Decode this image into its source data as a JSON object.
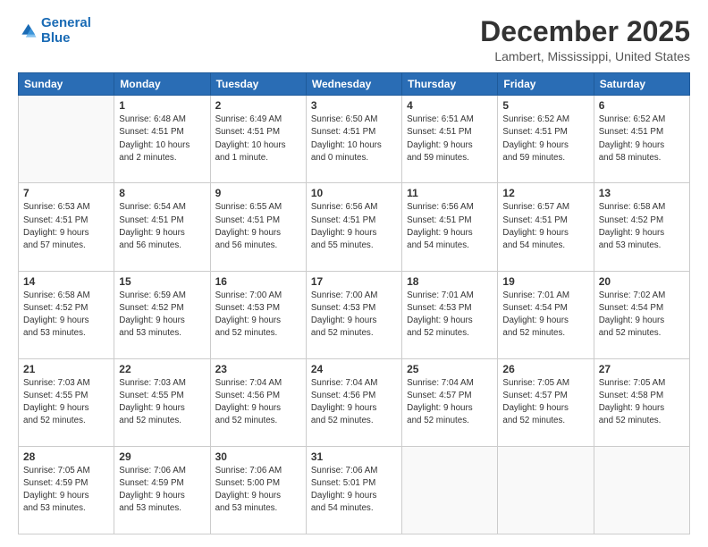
{
  "header": {
    "logo_line1": "General",
    "logo_line2": "Blue",
    "title": "December 2025",
    "subtitle": "Lambert, Mississippi, United States"
  },
  "calendar": {
    "weekdays": [
      "Sunday",
      "Monday",
      "Tuesday",
      "Wednesday",
      "Thursday",
      "Friday",
      "Saturday"
    ],
    "rows": [
      [
        {
          "day": "",
          "info": ""
        },
        {
          "day": "1",
          "info": "Sunrise: 6:48 AM\nSunset: 4:51 PM\nDaylight: 10 hours\nand 2 minutes."
        },
        {
          "day": "2",
          "info": "Sunrise: 6:49 AM\nSunset: 4:51 PM\nDaylight: 10 hours\nand 1 minute."
        },
        {
          "day": "3",
          "info": "Sunrise: 6:50 AM\nSunset: 4:51 PM\nDaylight: 10 hours\nand 0 minutes."
        },
        {
          "day": "4",
          "info": "Sunrise: 6:51 AM\nSunset: 4:51 PM\nDaylight: 9 hours\nand 59 minutes."
        },
        {
          "day": "5",
          "info": "Sunrise: 6:52 AM\nSunset: 4:51 PM\nDaylight: 9 hours\nand 59 minutes."
        },
        {
          "day": "6",
          "info": "Sunrise: 6:52 AM\nSunset: 4:51 PM\nDaylight: 9 hours\nand 58 minutes."
        }
      ],
      [
        {
          "day": "7",
          "info": "Sunrise: 6:53 AM\nSunset: 4:51 PM\nDaylight: 9 hours\nand 57 minutes."
        },
        {
          "day": "8",
          "info": "Sunrise: 6:54 AM\nSunset: 4:51 PM\nDaylight: 9 hours\nand 56 minutes."
        },
        {
          "day": "9",
          "info": "Sunrise: 6:55 AM\nSunset: 4:51 PM\nDaylight: 9 hours\nand 56 minutes."
        },
        {
          "day": "10",
          "info": "Sunrise: 6:56 AM\nSunset: 4:51 PM\nDaylight: 9 hours\nand 55 minutes."
        },
        {
          "day": "11",
          "info": "Sunrise: 6:56 AM\nSunset: 4:51 PM\nDaylight: 9 hours\nand 54 minutes."
        },
        {
          "day": "12",
          "info": "Sunrise: 6:57 AM\nSunset: 4:51 PM\nDaylight: 9 hours\nand 54 minutes."
        },
        {
          "day": "13",
          "info": "Sunrise: 6:58 AM\nSunset: 4:52 PM\nDaylight: 9 hours\nand 53 minutes."
        }
      ],
      [
        {
          "day": "14",
          "info": "Sunrise: 6:58 AM\nSunset: 4:52 PM\nDaylight: 9 hours\nand 53 minutes."
        },
        {
          "day": "15",
          "info": "Sunrise: 6:59 AM\nSunset: 4:52 PM\nDaylight: 9 hours\nand 53 minutes."
        },
        {
          "day": "16",
          "info": "Sunrise: 7:00 AM\nSunset: 4:53 PM\nDaylight: 9 hours\nand 52 minutes."
        },
        {
          "day": "17",
          "info": "Sunrise: 7:00 AM\nSunset: 4:53 PM\nDaylight: 9 hours\nand 52 minutes."
        },
        {
          "day": "18",
          "info": "Sunrise: 7:01 AM\nSunset: 4:53 PM\nDaylight: 9 hours\nand 52 minutes."
        },
        {
          "day": "19",
          "info": "Sunrise: 7:01 AM\nSunset: 4:54 PM\nDaylight: 9 hours\nand 52 minutes."
        },
        {
          "day": "20",
          "info": "Sunrise: 7:02 AM\nSunset: 4:54 PM\nDaylight: 9 hours\nand 52 minutes."
        }
      ],
      [
        {
          "day": "21",
          "info": "Sunrise: 7:03 AM\nSunset: 4:55 PM\nDaylight: 9 hours\nand 52 minutes."
        },
        {
          "day": "22",
          "info": "Sunrise: 7:03 AM\nSunset: 4:55 PM\nDaylight: 9 hours\nand 52 minutes."
        },
        {
          "day": "23",
          "info": "Sunrise: 7:04 AM\nSunset: 4:56 PM\nDaylight: 9 hours\nand 52 minutes."
        },
        {
          "day": "24",
          "info": "Sunrise: 7:04 AM\nSunset: 4:56 PM\nDaylight: 9 hours\nand 52 minutes."
        },
        {
          "day": "25",
          "info": "Sunrise: 7:04 AM\nSunset: 4:57 PM\nDaylight: 9 hours\nand 52 minutes."
        },
        {
          "day": "26",
          "info": "Sunrise: 7:05 AM\nSunset: 4:57 PM\nDaylight: 9 hours\nand 52 minutes."
        },
        {
          "day": "27",
          "info": "Sunrise: 7:05 AM\nSunset: 4:58 PM\nDaylight: 9 hours\nand 52 minutes."
        }
      ],
      [
        {
          "day": "28",
          "info": "Sunrise: 7:05 AM\nSunset: 4:59 PM\nDaylight: 9 hours\nand 53 minutes."
        },
        {
          "day": "29",
          "info": "Sunrise: 7:06 AM\nSunset: 4:59 PM\nDaylight: 9 hours\nand 53 minutes."
        },
        {
          "day": "30",
          "info": "Sunrise: 7:06 AM\nSunset: 5:00 PM\nDaylight: 9 hours\nand 53 minutes."
        },
        {
          "day": "31",
          "info": "Sunrise: 7:06 AM\nSunset: 5:01 PM\nDaylight: 9 hours\nand 54 minutes."
        },
        {
          "day": "",
          "info": ""
        },
        {
          "day": "",
          "info": ""
        },
        {
          "day": "",
          "info": ""
        }
      ]
    ]
  }
}
